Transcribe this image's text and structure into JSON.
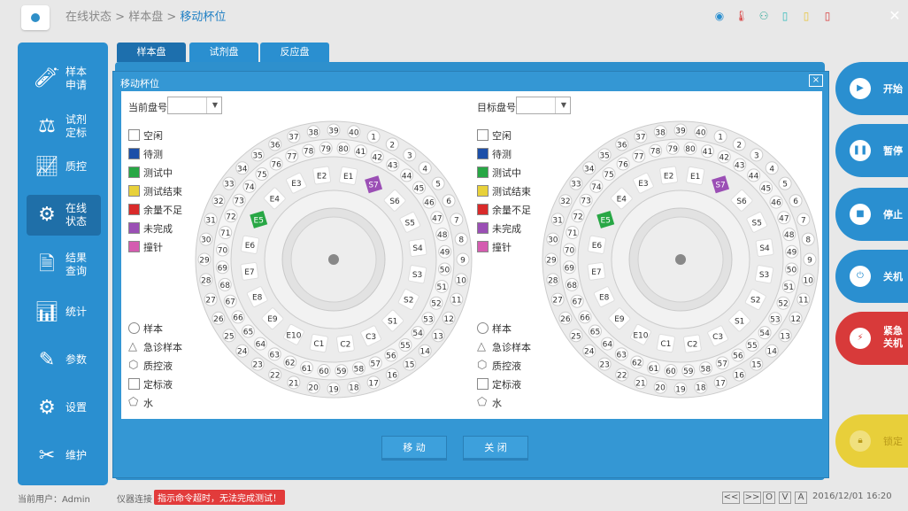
{
  "breadcrumb": {
    "part1": "在线状态",
    "sep": ">",
    "part2": "样本盘",
    "part3": "移动杯位"
  },
  "sidebar": [
    {
      "l1": "样本",
      "l2": "申请",
      "icon": "sample-tube-icon"
    },
    {
      "l1": "试剂",
      "l2": "定标",
      "icon": "balance-icon"
    },
    {
      "l1": "质控",
      "l2": "",
      "icon": "chart-line-icon"
    },
    {
      "l1": "在线",
      "l2": "状态",
      "icon": "gear-cog-icon"
    },
    {
      "l1": "结果",
      "l2": "查询",
      "icon": "doc-search-icon"
    },
    {
      "l1": "统计",
      "l2": "",
      "icon": "bar-chart-icon"
    },
    {
      "l1": "参数",
      "l2": "",
      "icon": "edit-icon"
    },
    {
      "l1": "设置",
      "l2": "",
      "icon": "settings-icon"
    },
    {
      "l1": "维护",
      "l2": "",
      "icon": "tools-icon"
    }
  ],
  "tabs": [
    "样本盘",
    "试剂盘",
    "反应盘"
  ],
  "dialog": {
    "title": "移动杯位",
    "close": "×",
    "current_label": "当前盘号",
    "target_label": "目标盘号",
    "move": "移 动",
    "close_btn": "关 闭"
  },
  "legend_colors": [
    {
      "label": "空闲",
      "color": "#ffffff"
    },
    {
      "label": "待测",
      "color": "#1c4fa8"
    },
    {
      "label": "测试中",
      "color": "#28a745"
    },
    {
      "label": "测试结束",
      "color": "#e8d13a"
    },
    {
      "label": "余量不足",
      "color": "#d92a2a"
    },
    {
      "label": "未完成",
      "color": "#9b4fb5"
    },
    {
      "label": "撞针",
      "color": "#d45cb0"
    }
  ],
  "legend_shapes": [
    {
      "label": "样本",
      "shape": "circle"
    },
    {
      "label": "急诊样本",
      "shape": "triangle"
    },
    {
      "label": "质控液",
      "shape": "hexagon"
    },
    {
      "label": "定标液",
      "shape": "square"
    },
    {
      "label": "水",
      "shape": "pentagon"
    }
  ],
  "disk": {
    "outer_numbers": [
      1,
      2,
      3,
      4,
      5,
      6,
      7,
      8,
      9,
      10,
      11,
      12,
      13,
      14,
      15,
      16,
      17,
      18,
      19,
      20,
      21,
      22,
      23,
      24,
      25,
      26,
      27,
      28,
      29,
      30,
      31,
      32,
      33,
      34,
      35,
      36,
      37,
      38,
      39,
      40
    ],
    "middle_numbers": [
      41,
      42,
      43,
      44,
      45,
      46,
      47,
      48,
      49,
      50,
      51,
      52,
      53,
      54,
      55,
      56,
      57,
      58,
      59,
      60,
      61,
      62,
      63,
      64,
      65,
      66,
      67,
      68,
      69,
      70,
      71,
      72,
      73,
      74,
      75,
      76,
      77,
      78,
      79,
      80
    ],
    "inner_labels": [
      "E1",
      "S7",
      "S6",
      "S5",
      "S4",
      "S3",
      "S2",
      "S1",
      "C3",
      "C2",
      "C1",
      "E10",
      "E9",
      "E8",
      "E7",
      "E6",
      "E5",
      "E4",
      "E3",
      "E2"
    ],
    "s7_color": "#9b4fb5",
    "e5_color": "#28a745"
  },
  "right_buttons": [
    {
      "label": "开始",
      "icon": "play-icon",
      "color": "#2a8fd0"
    },
    {
      "label": "暂停",
      "icon": "pause-icon",
      "color": "#2a8fd0"
    },
    {
      "label": "停止",
      "icon": "stop-icon",
      "color": "#2a8fd0"
    },
    {
      "label": "关机",
      "icon": "power-icon",
      "color": "#2a8fd0"
    },
    {
      "label": "紧急关机",
      "l1": "紧急",
      "l2": "关机",
      "icon": "plug-icon",
      "color": "#d83a3a"
    },
    {
      "label": "锁定",
      "icon": "lock-icon",
      "color": "#e8cf3a"
    }
  ],
  "status": {
    "user_label": "当前用户：",
    "user": "Admin",
    "conn_label": "仪器连接",
    "error": "指示命令超时，无法完成测试！",
    "nav": [
      "<<",
      ">>",
      "O",
      "V",
      "A"
    ],
    "datetime": "2016/12/01 16:20"
  }
}
